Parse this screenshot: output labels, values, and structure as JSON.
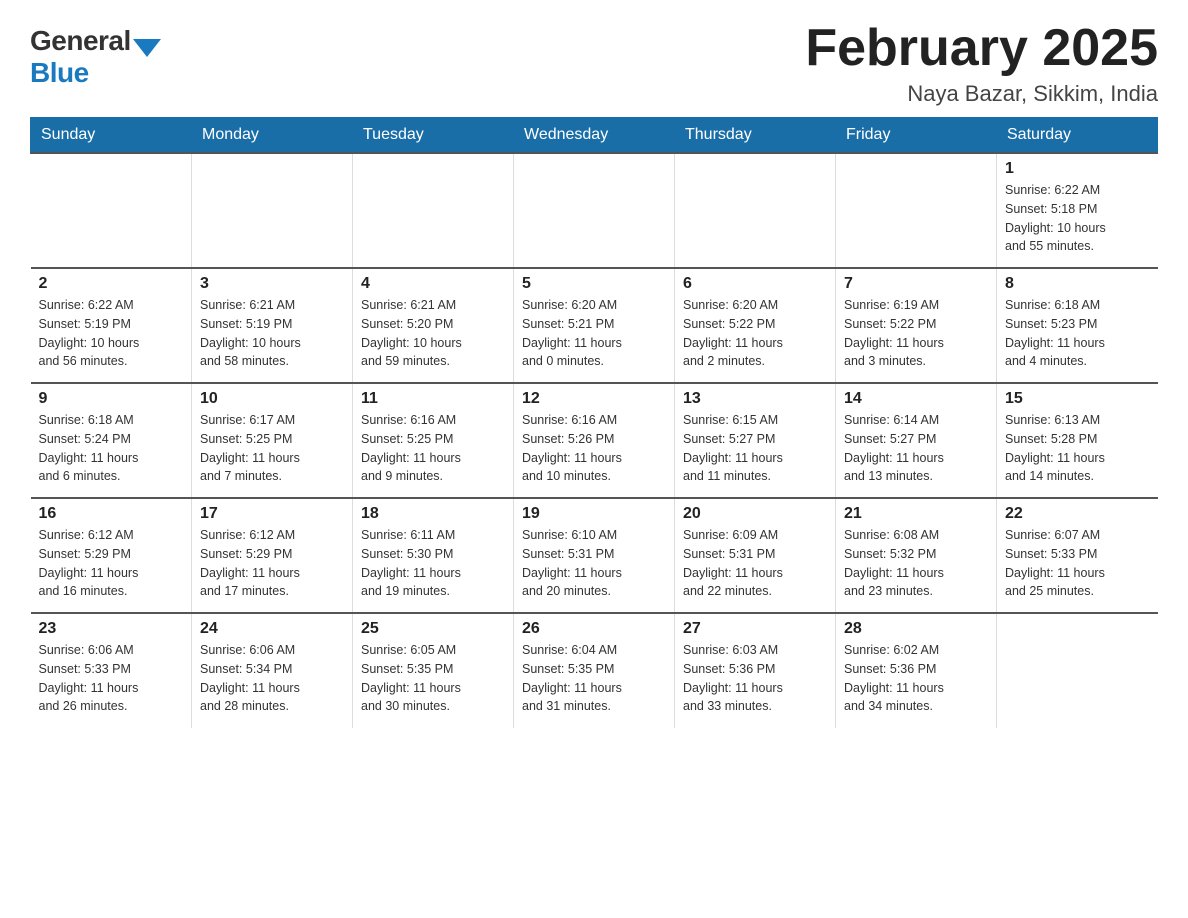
{
  "header": {
    "logo_general": "General",
    "logo_blue": "Blue",
    "title": "February 2025",
    "subtitle": "Naya Bazar, Sikkim, India"
  },
  "days_of_week": [
    "Sunday",
    "Monday",
    "Tuesday",
    "Wednesday",
    "Thursday",
    "Friday",
    "Saturday"
  ],
  "weeks": [
    [
      {
        "day": "",
        "info": []
      },
      {
        "day": "",
        "info": []
      },
      {
        "day": "",
        "info": []
      },
      {
        "day": "",
        "info": []
      },
      {
        "day": "",
        "info": []
      },
      {
        "day": "",
        "info": []
      },
      {
        "day": "1",
        "info": [
          "Sunrise: 6:22 AM",
          "Sunset: 5:18 PM",
          "Daylight: 10 hours",
          "and 55 minutes."
        ]
      }
    ],
    [
      {
        "day": "2",
        "info": [
          "Sunrise: 6:22 AM",
          "Sunset: 5:19 PM",
          "Daylight: 10 hours",
          "and 56 minutes."
        ]
      },
      {
        "day": "3",
        "info": [
          "Sunrise: 6:21 AM",
          "Sunset: 5:19 PM",
          "Daylight: 10 hours",
          "and 58 minutes."
        ]
      },
      {
        "day": "4",
        "info": [
          "Sunrise: 6:21 AM",
          "Sunset: 5:20 PM",
          "Daylight: 10 hours",
          "and 59 minutes."
        ]
      },
      {
        "day": "5",
        "info": [
          "Sunrise: 6:20 AM",
          "Sunset: 5:21 PM",
          "Daylight: 11 hours",
          "and 0 minutes."
        ]
      },
      {
        "day": "6",
        "info": [
          "Sunrise: 6:20 AM",
          "Sunset: 5:22 PM",
          "Daylight: 11 hours",
          "and 2 minutes."
        ]
      },
      {
        "day": "7",
        "info": [
          "Sunrise: 6:19 AM",
          "Sunset: 5:22 PM",
          "Daylight: 11 hours",
          "and 3 minutes."
        ]
      },
      {
        "day": "8",
        "info": [
          "Sunrise: 6:18 AM",
          "Sunset: 5:23 PM",
          "Daylight: 11 hours",
          "and 4 minutes."
        ]
      }
    ],
    [
      {
        "day": "9",
        "info": [
          "Sunrise: 6:18 AM",
          "Sunset: 5:24 PM",
          "Daylight: 11 hours",
          "and 6 minutes."
        ]
      },
      {
        "day": "10",
        "info": [
          "Sunrise: 6:17 AM",
          "Sunset: 5:25 PM",
          "Daylight: 11 hours",
          "and 7 minutes."
        ]
      },
      {
        "day": "11",
        "info": [
          "Sunrise: 6:16 AM",
          "Sunset: 5:25 PM",
          "Daylight: 11 hours",
          "and 9 minutes."
        ]
      },
      {
        "day": "12",
        "info": [
          "Sunrise: 6:16 AM",
          "Sunset: 5:26 PM",
          "Daylight: 11 hours",
          "and 10 minutes."
        ]
      },
      {
        "day": "13",
        "info": [
          "Sunrise: 6:15 AM",
          "Sunset: 5:27 PM",
          "Daylight: 11 hours",
          "and 11 minutes."
        ]
      },
      {
        "day": "14",
        "info": [
          "Sunrise: 6:14 AM",
          "Sunset: 5:27 PM",
          "Daylight: 11 hours",
          "and 13 minutes."
        ]
      },
      {
        "day": "15",
        "info": [
          "Sunrise: 6:13 AM",
          "Sunset: 5:28 PM",
          "Daylight: 11 hours",
          "and 14 minutes."
        ]
      }
    ],
    [
      {
        "day": "16",
        "info": [
          "Sunrise: 6:12 AM",
          "Sunset: 5:29 PM",
          "Daylight: 11 hours",
          "and 16 minutes."
        ]
      },
      {
        "day": "17",
        "info": [
          "Sunrise: 6:12 AM",
          "Sunset: 5:29 PM",
          "Daylight: 11 hours",
          "and 17 minutes."
        ]
      },
      {
        "day": "18",
        "info": [
          "Sunrise: 6:11 AM",
          "Sunset: 5:30 PM",
          "Daylight: 11 hours",
          "and 19 minutes."
        ]
      },
      {
        "day": "19",
        "info": [
          "Sunrise: 6:10 AM",
          "Sunset: 5:31 PM",
          "Daylight: 11 hours",
          "and 20 minutes."
        ]
      },
      {
        "day": "20",
        "info": [
          "Sunrise: 6:09 AM",
          "Sunset: 5:31 PM",
          "Daylight: 11 hours",
          "and 22 minutes."
        ]
      },
      {
        "day": "21",
        "info": [
          "Sunrise: 6:08 AM",
          "Sunset: 5:32 PM",
          "Daylight: 11 hours",
          "and 23 minutes."
        ]
      },
      {
        "day": "22",
        "info": [
          "Sunrise: 6:07 AM",
          "Sunset: 5:33 PM",
          "Daylight: 11 hours",
          "and 25 minutes."
        ]
      }
    ],
    [
      {
        "day": "23",
        "info": [
          "Sunrise: 6:06 AM",
          "Sunset: 5:33 PM",
          "Daylight: 11 hours",
          "and 26 minutes."
        ]
      },
      {
        "day": "24",
        "info": [
          "Sunrise: 6:06 AM",
          "Sunset: 5:34 PM",
          "Daylight: 11 hours",
          "and 28 minutes."
        ]
      },
      {
        "day": "25",
        "info": [
          "Sunrise: 6:05 AM",
          "Sunset: 5:35 PM",
          "Daylight: 11 hours",
          "and 30 minutes."
        ]
      },
      {
        "day": "26",
        "info": [
          "Sunrise: 6:04 AM",
          "Sunset: 5:35 PM",
          "Daylight: 11 hours",
          "and 31 minutes."
        ]
      },
      {
        "day": "27",
        "info": [
          "Sunrise: 6:03 AM",
          "Sunset: 5:36 PM",
          "Daylight: 11 hours",
          "and 33 minutes."
        ]
      },
      {
        "day": "28",
        "info": [
          "Sunrise: 6:02 AM",
          "Sunset: 5:36 PM",
          "Daylight: 11 hours",
          "and 34 minutes."
        ]
      },
      {
        "day": "",
        "info": []
      }
    ]
  ]
}
